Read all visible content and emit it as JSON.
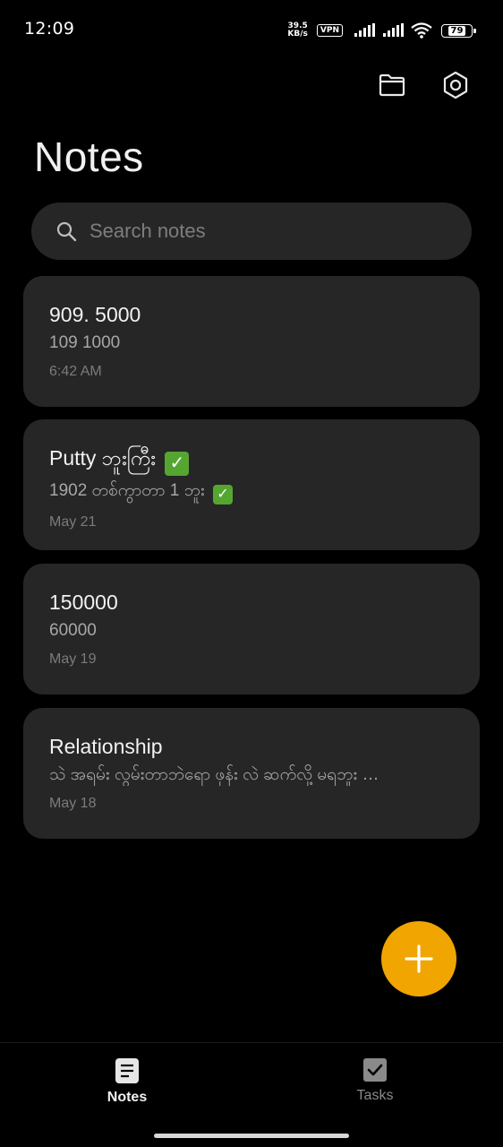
{
  "status_bar": {
    "time": "12:09",
    "net_speed_value": "39.5",
    "net_speed_unit": "KB/s",
    "vpn": "VPN",
    "battery": "79"
  },
  "header": {
    "title": "Notes",
    "folder_icon": "folder-icon",
    "settings_icon": "gear-icon"
  },
  "search": {
    "placeholder": "Search notes"
  },
  "notes": [
    {
      "title": "909. 5000",
      "snippet": "109 1000",
      "date": "6:42 AM"
    },
    {
      "title": "Putty ဘူးကြီး",
      "snippet": "1902  တစ်ကွာတာ 1 ဘူး",
      "date": "May 21"
    },
    {
      "title": "150000",
      "snippet": "60000",
      "date": "May 19"
    },
    {
      "title": "Relationship",
      "snippet": "သဲ အရမ်း လွမ်းတာဘဲရော ဖုန်း လဲ ဆက်လို့ မရဘူး …",
      "date": "May 18"
    }
  ],
  "fab": {
    "icon": "plus-icon"
  },
  "bottom_nav": {
    "notes_label": "Notes",
    "tasks_label": "Tasks"
  },
  "colors": {
    "background": "#000000",
    "card": "#262626",
    "accent": "#f0a500",
    "check": "#55a630"
  }
}
